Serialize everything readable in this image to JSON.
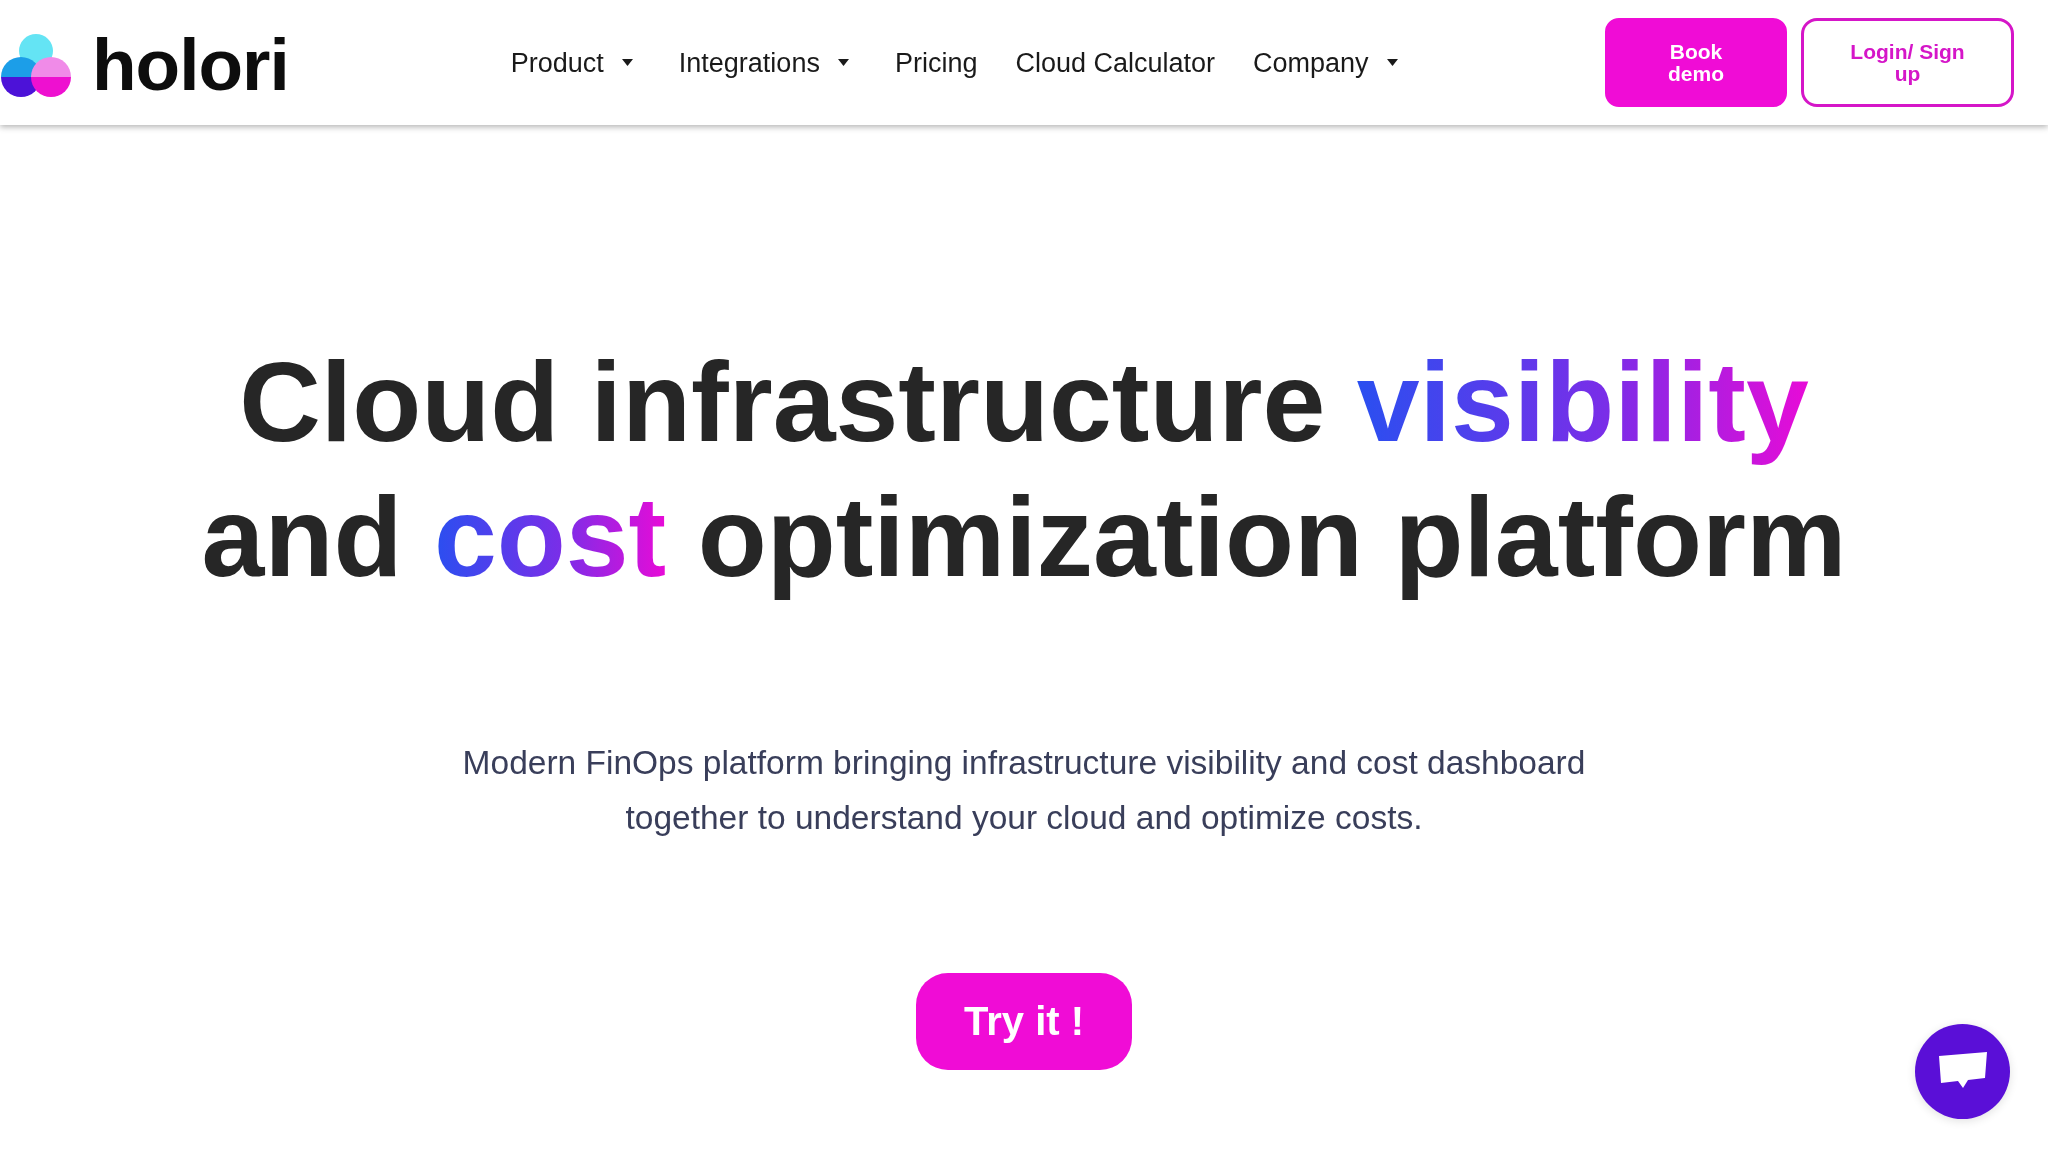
{
  "header": {
    "brand": "holori",
    "nav": [
      {
        "label": "Product",
        "has_dropdown": true
      },
      {
        "label": "Integrations",
        "has_dropdown": true
      },
      {
        "label": "Pricing",
        "has_dropdown": false
      },
      {
        "label": "Cloud Calculator",
        "has_dropdown": false
      },
      {
        "label": "Company",
        "has_dropdown": true
      }
    ],
    "buttons": [
      {
        "label": "Book demo",
        "kind": "filled"
      },
      {
        "label": "Login/ Sign up",
        "kind": "outline"
      }
    ]
  },
  "hero": {
    "heading": [
      {
        "text": "Cloud infrastructure ",
        "kind": "plain"
      },
      {
        "text": "visibility",
        "kind": "gradient"
      },
      {
        "text": " and ",
        "kind": "plain"
      },
      {
        "text": "cost",
        "kind": "gradient"
      },
      {
        "text": " optimization platform",
        "kind": "plain"
      }
    ],
    "subtitle": "Modern FinOps platform bringing infrastructure visibility and cost dashboard together to understand your cloud and optimize costs.",
    "cta": "Try it !"
  }
}
